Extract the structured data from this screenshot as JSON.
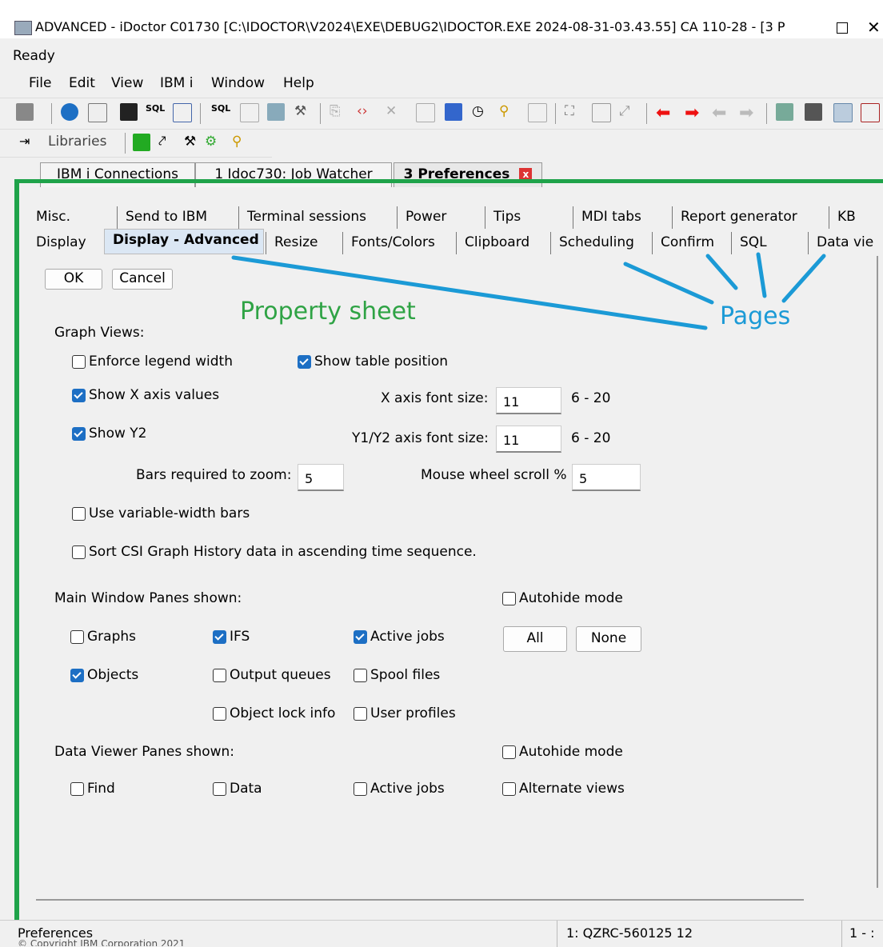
{
  "window": {
    "title": "ADVANCED - iDoctor C01730   [C:\\IDOCTOR\\V2024\\EXE\\DEBUG2\\IDOCTOR.EXE 2024-08-31-03.43.55] CA 110-28 - [3 P",
    "status": "Ready"
  },
  "menu": [
    "File",
    "Edit",
    "View",
    "IBM i",
    "Window",
    "Help"
  ],
  "toolbar2": {
    "libraries_label": "Libraries"
  },
  "doc_tabs": [
    {
      "label": "IBM i Connections"
    },
    {
      "label": "1 Idoc730:  Job Watcher"
    },
    {
      "label": "3 Preferences",
      "close": "x"
    }
  ],
  "pages_row1": [
    "Misc.",
    "Send to IBM",
    "Terminal sessions",
    "Power",
    "Tips",
    "MDI tabs",
    "Report generator",
    "KB"
  ],
  "pages_row2": [
    "Display",
    "Display - Advanced",
    "Resize",
    "Fonts/Colors",
    "Clipboard",
    "Scheduling",
    "Confirm",
    "SQL",
    "Data vie"
  ],
  "buttons": {
    "ok": "OK",
    "cancel": "Cancel",
    "all": "All",
    "none": "None"
  },
  "annotations": {
    "property_sheet": "Property sheet",
    "pages": "Pages"
  },
  "graph_views": {
    "heading": "Graph Views:",
    "enforce_legend": {
      "label": "Enforce legend width",
      "checked": false
    },
    "show_table_position": {
      "label": "Show table position",
      "checked": true
    },
    "show_x_axis": {
      "label": "Show X axis values",
      "checked": true
    },
    "x_font_label": "X axis font size:",
    "x_font_value": "11",
    "x_font_range": "6 - 20",
    "show_y2": {
      "label": "Show Y2",
      "checked": true
    },
    "y_font_label": "Y1/Y2 axis font size:",
    "y_font_value": "11",
    "y_font_range": "6 - 20",
    "bars_zoom_label": "Bars required to zoom:",
    "bars_zoom_value": "5",
    "mouse_wheel_label": "Mouse wheel scroll %",
    "mouse_wheel_value": "5",
    "variable_width": {
      "label": "Use variable-width bars",
      "checked": false
    },
    "sort_csi": {
      "label": "Sort CSI Graph History data in ascending time sequence.",
      "checked": false
    }
  },
  "main_panes": {
    "heading": "Main Window Panes shown:",
    "autohide": {
      "label": "Autohide mode",
      "checked": false
    },
    "graphs": {
      "label": "Graphs",
      "checked": false
    },
    "ifs": {
      "label": "IFS",
      "checked": true
    },
    "active_jobs": {
      "label": "Active jobs",
      "checked": true
    },
    "objects": {
      "label": "Objects",
      "checked": true
    },
    "output_queues": {
      "label": "Output queues",
      "checked": false
    },
    "spool_files": {
      "label": "Spool files",
      "checked": false
    },
    "object_lock": {
      "label": "Object lock info",
      "checked": false
    },
    "user_profiles": {
      "label": "User profiles",
      "checked": false
    }
  },
  "data_viewer": {
    "heading": "Data Viewer Panes shown:",
    "autohide": {
      "label": "Autohide mode",
      "checked": false
    },
    "find": {
      "label": "Find",
      "checked": false
    },
    "data": {
      "label": "Data",
      "checked": false
    },
    "active_jobs": {
      "label": "Active jobs",
      "checked": false
    },
    "alternate_views": {
      "label": "Alternate views",
      "checked": false
    }
  },
  "statusbar": {
    "left": "Preferences",
    "middle": "1: QZRC-560125  12",
    "right": "1 - :",
    "copyright": "© Copyright IBM Corporation 2021"
  }
}
